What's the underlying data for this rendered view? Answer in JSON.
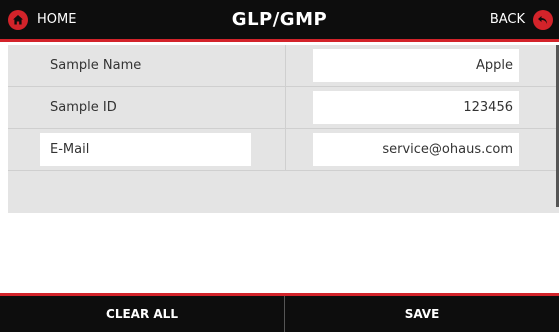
{
  "header": {
    "title": "GLP/GMP",
    "home_label": "HOME",
    "back_label": "BACK"
  },
  "fields": [
    {
      "label": "Sample Name",
      "value": "Apple"
    },
    {
      "label": "Sample ID",
      "value": "123456"
    },
    {
      "label": "E-Mail",
      "value": "service@ohaus.com"
    }
  ],
  "footer": {
    "clear_label": "CLEAR ALL",
    "save_label": "SAVE"
  },
  "colors": {
    "accent": "#d3232a",
    "bar_background": "#0d0d0d",
    "table_background": "#e4e4e4"
  },
  "icons": {
    "home": "home-icon",
    "back": "back-arrow-icon"
  }
}
